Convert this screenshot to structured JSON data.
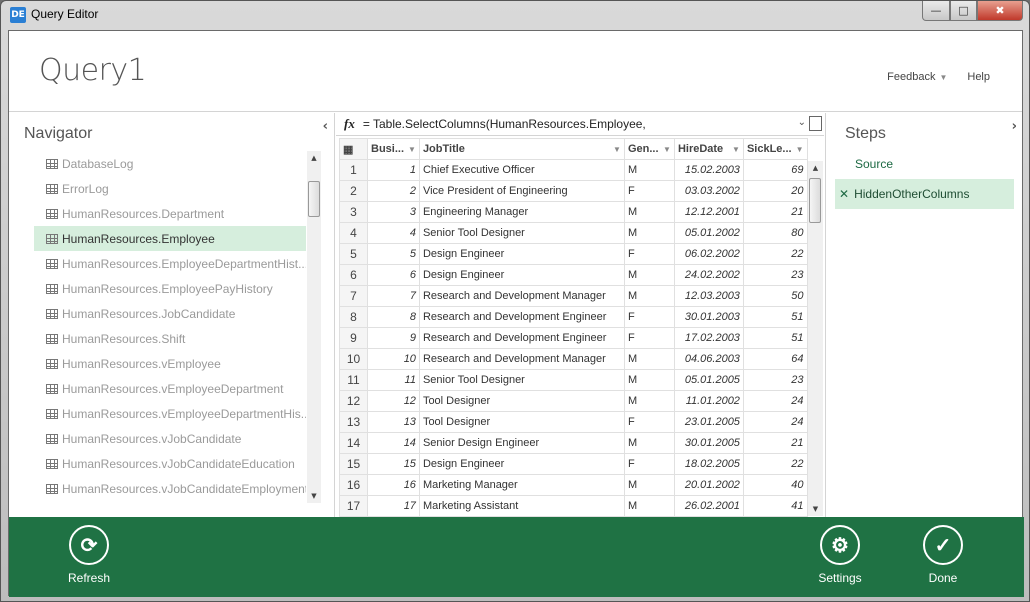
{
  "window": {
    "title": "Query Editor",
    "app_icon": "DE",
    "controls": {
      "minimize": "—",
      "maximize": "□",
      "close": "✖"
    }
  },
  "header": {
    "query_name": "Query1",
    "feedback_label": "Feedback",
    "help_label": "Help"
  },
  "navigator": {
    "title": "Navigator",
    "collapse_icon": "‹",
    "items": [
      {
        "label": "DatabaseLog",
        "selected": false
      },
      {
        "label": "ErrorLog",
        "selected": false
      },
      {
        "label": "HumanResources.Department",
        "selected": false
      },
      {
        "label": "HumanResources.Employee",
        "selected": true
      },
      {
        "label": "HumanResources.EmployeeDepartmentHist...",
        "selected": false
      },
      {
        "label": "HumanResources.EmployeePayHistory",
        "selected": false
      },
      {
        "label": "HumanResources.JobCandidate",
        "selected": false
      },
      {
        "label": "HumanResources.Shift",
        "selected": false
      },
      {
        "label": "HumanResources.vEmployee",
        "selected": false
      },
      {
        "label": "HumanResources.vEmployeeDepartment",
        "selected": false
      },
      {
        "label": "HumanResources.vEmployeeDepartmentHis...",
        "selected": false
      },
      {
        "label": "HumanResources.vJobCandidate",
        "selected": false
      },
      {
        "label": "HumanResources.vJobCandidateEducation",
        "selected": false
      },
      {
        "label": "HumanResources.vJobCandidateEmployment",
        "selected": false
      }
    ]
  },
  "formula": {
    "fx_label": "fx",
    "text": "= Table.SelectColumns(HumanResources.Employee,"
  },
  "grid": {
    "columns": [
      "Busi...",
      "JobTitle",
      "Gen...",
      "HireDate",
      "SickLe..."
    ],
    "rows": [
      [
        "1",
        "1",
        "Chief Executive Officer",
        "M",
        "15.02.2003",
        "69"
      ],
      [
        "2",
        "2",
        "Vice President of Engineering",
        "F",
        "03.03.2002",
        "20"
      ],
      [
        "3",
        "3",
        "Engineering Manager",
        "M",
        "12.12.2001",
        "21"
      ],
      [
        "4",
        "4",
        "Senior Tool Designer",
        "M",
        "05.01.2002",
        "80"
      ],
      [
        "5",
        "5",
        "Design Engineer",
        "F",
        "06.02.2002",
        "22"
      ],
      [
        "6",
        "6",
        "Design Engineer",
        "M",
        "24.02.2002",
        "23"
      ],
      [
        "7",
        "7",
        "Research and Development Manager",
        "M",
        "12.03.2003",
        "50"
      ],
      [
        "8",
        "8",
        "Research and Development Engineer",
        "F",
        "30.01.2003",
        "51"
      ],
      [
        "9",
        "9",
        "Research and Development Engineer",
        "F",
        "17.02.2003",
        "51"
      ],
      [
        "10",
        "10",
        "Research and Development Manager",
        "M",
        "04.06.2003",
        "64"
      ],
      [
        "11",
        "11",
        "Senior Tool Designer",
        "M",
        "05.01.2005",
        "23"
      ],
      [
        "12",
        "12",
        "Tool Designer",
        "M",
        "11.01.2002",
        "24"
      ],
      [
        "13",
        "13",
        "Tool Designer",
        "F",
        "23.01.2005",
        "24"
      ],
      [
        "14",
        "14",
        "Senior Design Engineer",
        "M",
        "30.01.2005",
        "21"
      ],
      [
        "15",
        "15",
        "Design Engineer",
        "F",
        "18.02.2005",
        "22"
      ],
      [
        "16",
        "16",
        "Marketing Manager",
        "M",
        "20.01.2002",
        "40"
      ],
      [
        "17",
        "17",
        "Marketing Assistant",
        "M",
        "26.02.2001",
        "41"
      ]
    ]
  },
  "steps": {
    "title": "Steps",
    "expand_icon": "›",
    "items": [
      {
        "label": "Source",
        "deletable": false
      },
      {
        "label": "HiddenOtherColumns",
        "deletable": true,
        "selected": true
      }
    ]
  },
  "footer": {
    "accent": "#1f7244",
    "refresh_label": "Refresh",
    "settings_label": "Settings",
    "done_label": "Done"
  }
}
